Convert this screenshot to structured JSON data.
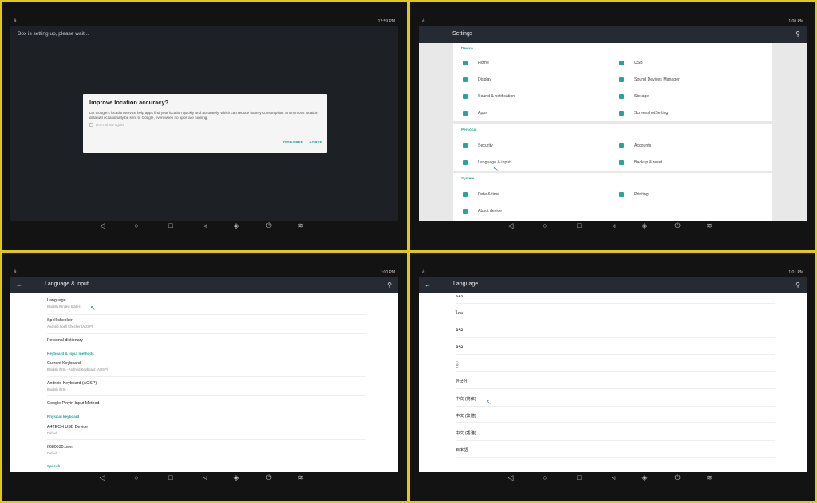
{
  "panel1": {
    "status_hash": "#",
    "time": "12:59 PM",
    "setup_text": "Box is setting up, please wait...",
    "dialog": {
      "title": "Improve location accuracy?",
      "body": "Let Google's location service help apps find your location quickly and accurately, which can reduce battery consumption. Anonymous location data will occasionally be sent to Google, even when no apps are running.",
      "checkbox_label": "Don't show again",
      "disagree": "DISAGREE",
      "agree": "AGREE"
    }
  },
  "panel2": {
    "status_hash": "#",
    "time": "1:00 PM",
    "title": "Settings",
    "sections": {
      "device": "Device",
      "personal": "Personal",
      "system": "System"
    },
    "items": {
      "home": "Home",
      "usb": "USB",
      "display": "Display",
      "sound_devices": "Sound Devices Manager",
      "sound_notification": "Sound & notification",
      "storage": "Storage",
      "apps": "Apps",
      "screenshot": "ScreenshotSetting",
      "security": "Security",
      "accounts": "Accounts",
      "language_input": "Language & input",
      "backup": "Backup & reset",
      "date_time": "Date & time",
      "printing": "Printing",
      "about": "About device"
    }
  },
  "panel3": {
    "status_hash": "#",
    "time": "1:00 PM",
    "title": "Language & input",
    "language": {
      "title": "Language",
      "sub": "English (United States)"
    },
    "spell": {
      "title": "Spell checker",
      "sub": "Android Spell Checker (AOSP)"
    },
    "dictionary": {
      "title": "Personal dictionary"
    },
    "keyboard_header": "Keyboard & input methods",
    "current_keyboard": {
      "title": "Current Keyboard",
      "sub": "English (US) - Android Keyboard (AOSP)"
    },
    "android_keyboard": {
      "title": "Android Keyboard (AOSP)",
      "sub": "English (US)"
    },
    "pinyin": {
      "title": "Google Pinyin Input Method"
    },
    "physical_header": "Physical keyboard",
    "a4tech": {
      "title": "A4TECH USB Device",
      "sub": "Default"
    },
    "pwm": {
      "title": "ff680030.pwm",
      "sub": "Default"
    },
    "speech_header": "Speech"
  },
  "panel4": {
    "status_hash": "#",
    "time": "1:01 PM",
    "title": "Language",
    "languages": [
      "ລາວ",
      "ไทย",
      "ລາວ",
      "ລາວ",
      "ဖြ",
      "한국어",
      "中文 (简体)",
      "中文 (繁體)",
      "中文 (香港)",
      "日本語"
    ]
  }
}
